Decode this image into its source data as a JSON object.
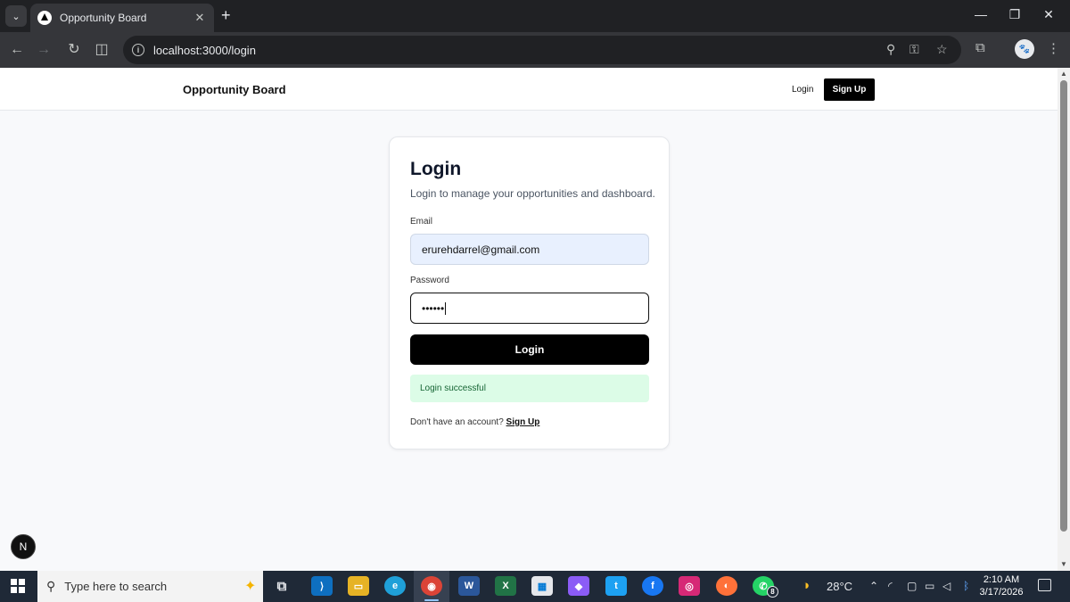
{
  "browser": {
    "tab_title": "Opportunity Board",
    "tab_close": "✕",
    "new_tab": "+",
    "url": "localhost:3000/login",
    "window_controls": {
      "minimize": "—",
      "restore": "❐",
      "close": "✕"
    }
  },
  "site": {
    "brand": "Opportunity Board",
    "nav_login": "Login",
    "nav_signup": "Sign Up"
  },
  "login": {
    "title": "Login",
    "subtitle": "Login to manage your opportunities and dashboard.",
    "email_label": "Email",
    "email_value": "erurehdarrel@gmail.com",
    "password_label": "Password",
    "password_value": "••••••",
    "submit_label": "Login",
    "success_message": "Login successful",
    "footer_text": "Don't have an account?",
    "footer_link": "Sign Up"
  },
  "dev_badge": "N",
  "taskbar": {
    "search_placeholder": "Type here to search",
    "whatsapp_badge": "8",
    "weather": "28°C",
    "time": "2:10 AM",
    "date": "3/17/2026"
  },
  "icons": [
    "tab-search-icon",
    "back-arrow-icon",
    "forward-arrow-icon",
    "reload-icon",
    "split-view-icon",
    "site-info-icon",
    "zoom-icon",
    "password-key-icon",
    "bookmark-star-icon",
    "extensions-icon",
    "profile-icon",
    "menu-kebab-icon",
    "windows-start-icon",
    "search-icon",
    "copilot-sparkle-icon",
    "task-view-icon",
    "vscode-icon",
    "file-explorer-icon",
    "edge-icon",
    "chrome-icon",
    "word-icon",
    "excel-icon",
    "store-icon",
    "copilot-icon",
    "twitter-icon",
    "facebook-icon",
    "instagram-icon",
    "firefox-icon",
    "whatsapp-icon",
    "weather-icon",
    "tray-chevron-icon",
    "wifi-icon",
    "meet-icon",
    "battery-icon",
    "volume-icon",
    "bluetooth-icon",
    "notification-icon"
  ],
  "colors": {
    "accent_black": "#000000",
    "success_bg": "#dcfce7",
    "success_text": "#166534",
    "email_field_bg": "#e8f0fe"
  }
}
